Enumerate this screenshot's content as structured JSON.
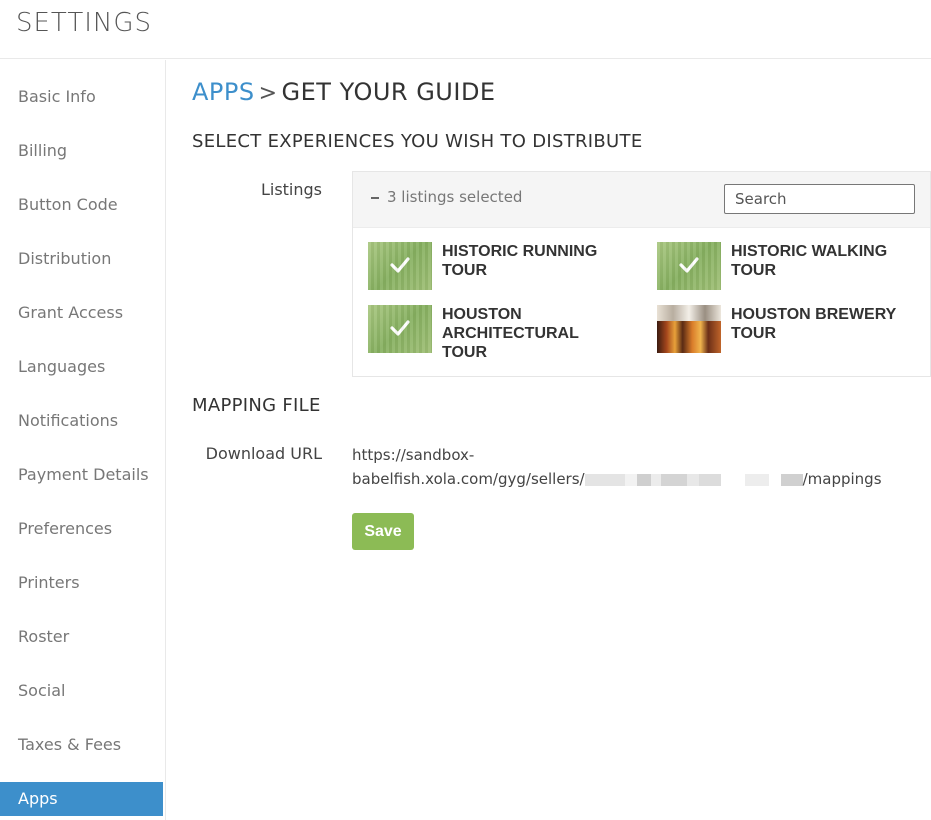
{
  "header": {
    "title": "SETTINGS"
  },
  "sidebar": {
    "items": [
      {
        "label": "Basic Info"
      },
      {
        "label": "Billing"
      },
      {
        "label": "Button Code"
      },
      {
        "label": "Distribution"
      },
      {
        "label": "Grant Access"
      },
      {
        "label": "Languages"
      },
      {
        "label": "Notifications"
      },
      {
        "label": "Payment Details"
      },
      {
        "label": "Preferences"
      },
      {
        "label": "Printers"
      },
      {
        "label": "Roster"
      },
      {
        "label": "Social"
      },
      {
        "label": "Taxes & Fees"
      },
      {
        "label": "Apps"
      }
    ],
    "active": "Apps"
  },
  "main": {
    "breadcrumb_link": "APPS",
    "breadcrumb_sep": ">",
    "breadcrumb_current": "GET YOUR GUIDE",
    "experiences_title": "SELECT EXPERIENCES YOU WISH TO DISTRIBUTE",
    "listings_label": "Listings",
    "selected_count": "3 listings selected",
    "search_placeholder": "Search",
    "listings": [
      {
        "name": "HISTORIC RUNNING TOUR",
        "selected": true
      },
      {
        "name": "HISTORIC WALKING TOUR",
        "selected": true
      },
      {
        "name": "HOUSTON ARCHITECTURAL TOUR",
        "selected": true
      },
      {
        "name": "HOUSTON BREWERY TOUR",
        "selected": false
      }
    ],
    "mapping_title": "MAPPING FILE",
    "download_label": "Download URL",
    "download_url_line1": "https://sandbox-",
    "download_url_prefix": "babelfish.xola.com/gyg/sellers/",
    "download_url_suffix": "/mappings",
    "save_label": "Save"
  },
  "colors": {
    "accent": "#3d8fcb",
    "save": "#8cbb55",
    "check": "#ffffff"
  },
  "icons": {
    "collapse": "minus-icon",
    "selected": "checkmark-icon"
  }
}
